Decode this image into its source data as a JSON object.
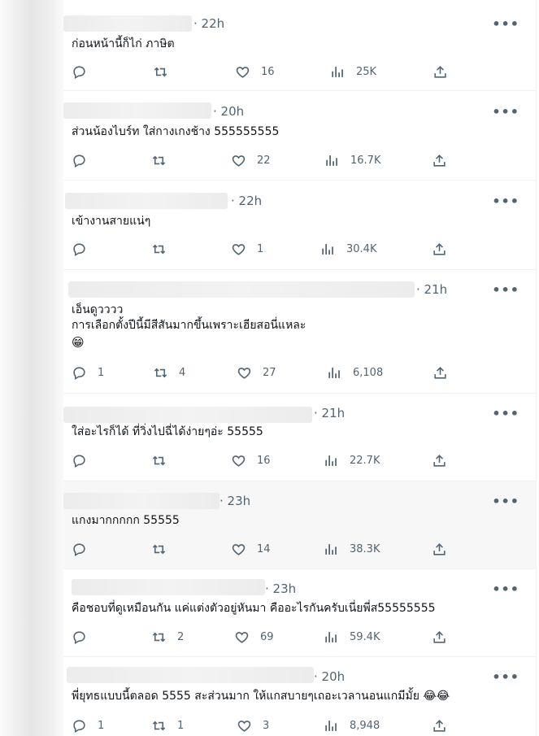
{
  "tweets": [
    {
      "time": "· 22h",
      "lines": [
        "ก่อนหน้านี้ก็ไก่ ภาษิต"
      ],
      "replies": "",
      "retweets": "",
      "likes": "16",
      "views": "25K"
    },
    {
      "time": "· 20h",
      "lines": [
        "ส่วนน้องไบร์ท ใส่กางเกงช้าง 555555555"
      ],
      "replies": "",
      "retweets": "",
      "likes": "22",
      "views": "16.7K"
    },
    {
      "time": "· 22h",
      "lines": [
        "เข้างานสายแน่ๆ"
      ],
      "replies": "",
      "retweets": "",
      "likes": "1",
      "views": "30.4K"
    },
    {
      "time": "· 21h",
      "lines": [
        "เอ็นดูวววว",
        "การเลือกตั้งปีนี้มีสีสันมากขึ้นเพราะเฮียสอนี่แหละ"
      ],
      "emoji": "😁",
      "replies": "1",
      "retweets": "4",
      "likes": "27",
      "views": "6,108"
    },
    {
      "time": "· 21h",
      "lines": [
        "ใส่อะไรก็ได้ ที่วิ่งไปฉี่ได้ง่ายๆอ่ะ 55555"
      ],
      "replies": "",
      "retweets": "",
      "likes": "16",
      "views": "22.7K"
    },
    {
      "time": "· 23h",
      "lines": [
        "แกงมากกกกก 55555"
      ],
      "replies": "",
      "retweets": "",
      "likes": "14",
      "views": "38.3K"
    },
    {
      "time": "· 23h",
      "lines": [
        "คือชอบที่ดูเหมือนกัน แค่แต่งตัวอยู่หันมา คืออะไรกันครับเนี่ยพี่ส55555555"
      ],
      "replies": "",
      "retweets": "2",
      "likes": "69",
      "views": "59.4K"
    },
    {
      "time": "· 20h",
      "lines": [
        "พี่ยุทธแบบนี้ตลอด 5555 สะส่วนมาก ให้แกสบายๆเถอะเวลานอนแกมีมั้ย 😂😂"
      ],
      "replies": "1",
      "retweets": "1",
      "likes": "3",
      "views": "8,948"
    }
  ],
  "icons": {
    "reply": "reply-icon",
    "retweet": "retweet-icon",
    "like": "heart-icon",
    "views": "views-icon",
    "share": "share-icon",
    "more": "more-icon"
  },
  "more_glyph": "•••"
}
